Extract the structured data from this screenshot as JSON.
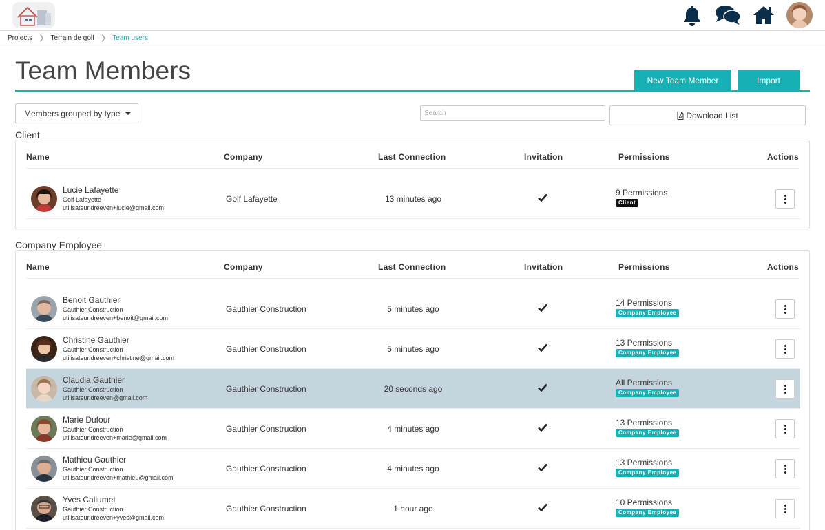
{
  "breadcrumb": [
    "Projects",
    "Terrain de golf",
    "Team users"
  ],
  "page_title": "Team Members",
  "buttons": {
    "new_member": "New Team Member",
    "import": "Import",
    "download": "Download List"
  },
  "filter": {
    "grouping": "Members grouped by type",
    "search_placeholder": "Search"
  },
  "columns": [
    "Name",
    "Company",
    "Last Connection",
    "Invitation",
    "Permissions",
    "Actions"
  ],
  "colors": {
    "accent": "#17b0b4",
    "selected_row": "#c5d5dd",
    "client_badge": "#111111"
  },
  "groups": [
    {
      "label": "Client",
      "members": [
        {
          "name": "Lucie Lafayette",
          "company_line": "Golf Lafayette",
          "email": "utilisateur.dreeven+lucie@gmail.com",
          "company": "Golf Lafayette",
          "last_connection": "13 minutes ago",
          "invited": true,
          "permissions": "9 Permissions",
          "badge": "Client"
        }
      ]
    },
    {
      "label": "Company Employee",
      "members": [
        {
          "name": "Benoit Gauthier",
          "company_line": "Gauthier Construction",
          "email": "utilisateur.dreeven+benoit@gmail.com",
          "company": "Gauthier Construction",
          "last_connection": "5 minutes ago",
          "invited": true,
          "permissions": "14 Permissions",
          "badge": "Company Employee"
        },
        {
          "name": "Christine Gauthier",
          "company_line": "Gauthier Construction",
          "email": "utilisateur.dreeven+christine@gmail.com",
          "company": "Gauthier Construction",
          "last_connection": "5 minutes ago",
          "invited": true,
          "permissions": "13 Permissions",
          "badge": "Company Employee"
        },
        {
          "name": "Claudia Gauthier",
          "company_line": "Gauthier Construction",
          "email": "utilisateur.dreeven@gmail.com",
          "company": "Gauthier Construction",
          "last_connection": "20 seconds ago",
          "invited": true,
          "permissions": "All Permissions",
          "badge": "Company Employee",
          "selected": true
        },
        {
          "name": "Marie Dufour",
          "company_line": "Gauthier Construction",
          "email": "utilisateur.dreeven+marie@gmail.com",
          "company": "Gauthier Construction",
          "last_connection": "4 minutes ago",
          "invited": true,
          "permissions": "13 Permissions",
          "badge": "Company Employee"
        },
        {
          "name": "Mathieu Gauthier",
          "company_line": "Gauthier Construction",
          "email": "utilisateur.dreeven+mathieu@gmail.com",
          "company": "Gauthier Construction",
          "last_connection": "4 minutes ago",
          "invited": true,
          "permissions": "13 Permissions",
          "badge": "Company Employee"
        },
        {
          "name": "Yves Callumet",
          "company_line": "Gauthier Construction",
          "email": "utilisateur.dreeven+yves@gmail.com",
          "company": "Gauthier Construction",
          "last_connection": "1 hour ago",
          "invited": true,
          "permissions": "10 Permissions",
          "badge": "Company Employee"
        }
      ]
    }
  ]
}
